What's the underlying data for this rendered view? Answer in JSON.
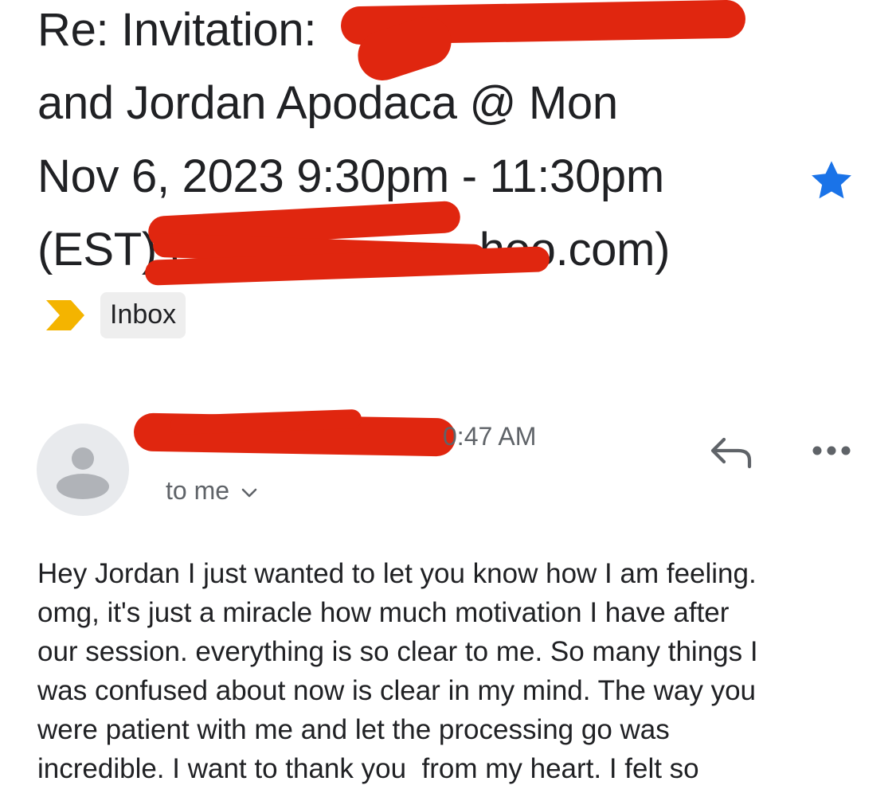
{
  "email": {
    "subject_lines": [
      "Re: Invitation:",
      "and Jordan Apodaca @ Mon",
      "Nov 6, 2023 9:30pm - 11:30pm",
      "(EST) (",
      "hoo.com)"
    ],
    "starred": true,
    "label": "Inbox",
    "message": {
      "time": "0:47 AM",
      "recipient": "to me",
      "body_lines": [
        "Hey Jordan I just wanted to let you know how I am feeling.",
        "omg, it's just a miracle how much motivation I have after",
        "our session. everything is so clear to me. So many things I",
        "was confused about now is clear in my mind. The way you",
        "were patient with me and let the processing go was",
        "incredible. I want to thank you  from my heart. I felt so"
      ]
    }
  },
  "icons": {
    "star": "star-icon",
    "importance": "importance-marker-icon",
    "avatar": "person-icon",
    "chevron": "chevron-down-icon",
    "reply": "reply-icon",
    "more": "more-horiz-icon"
  },
  "colors": {
    "star": "#1a73e8",
    "importance": "#f4b400",
    "redaction": "#e0260f",
    "secondary_text": "#5f6368"
  }
}
